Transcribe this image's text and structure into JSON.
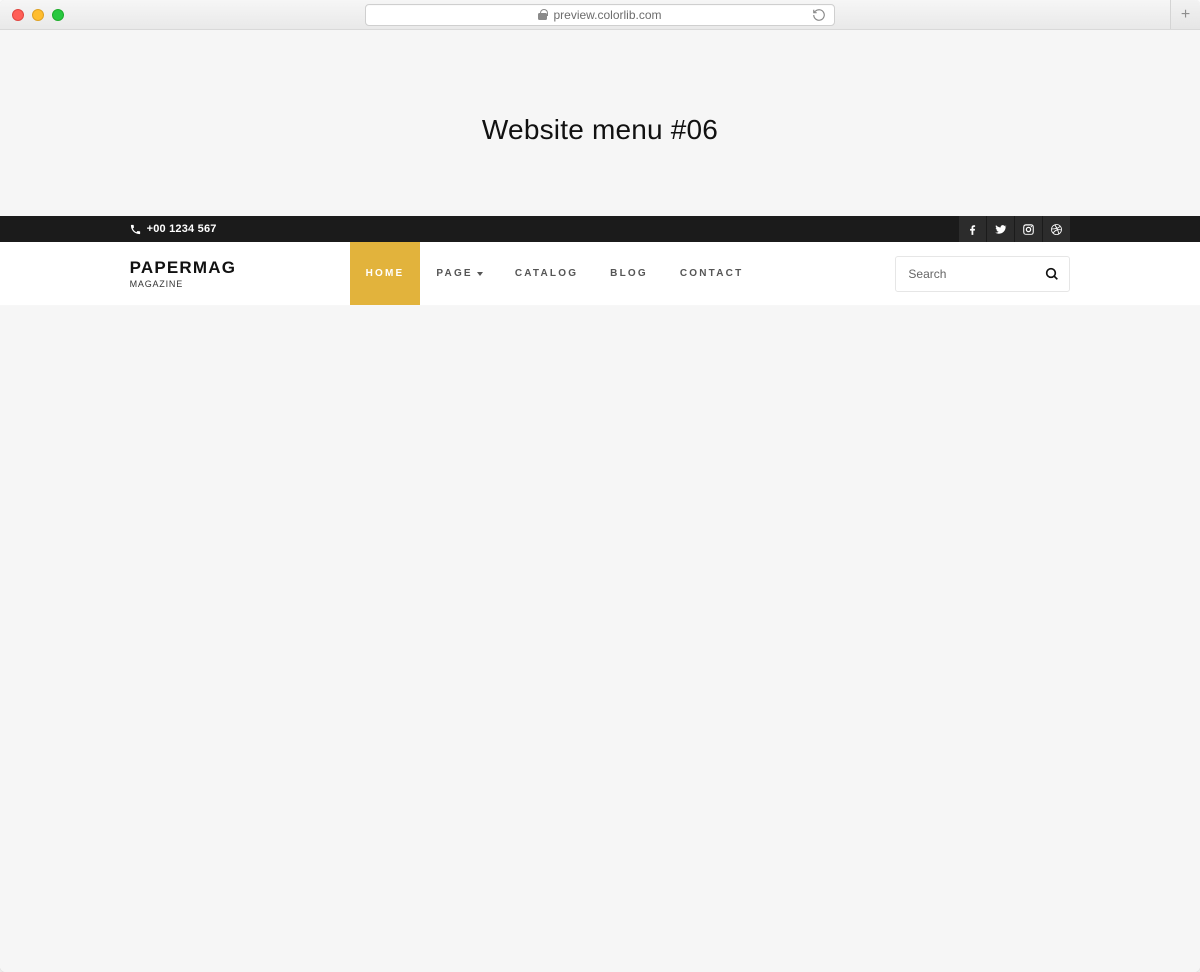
{
  "browser": {
    "address": "preview.colorlib.com"
  },
  "hero": {
    "title": "Website menu #06"
  },
  "topbar": {
    "phone": "+00 1234 567",
    "social": [
      "facebook",
      "twitter",
      "instagram",
      "dribbble"
    ]
  },
  "brand": {
    "title": "PAPERMAG",
    "subtitle": "MAGAZINE"
  },
  "nav": {
    "items": [
      {
        "label": "HOME",
        "active": true,
        "dropdown": false
      },
      {
        "label": "PAGE",
        "active": false,
        "dropdown": true
      },
      {
        "label": "CATALOG",
        "active": false,
        "dropdown": false
      },
      {
        "label": "BLOG",
        "active": false,
        "dropdown": false
      },
      {
        "label": "CONTACT",
        "active": false,
        "dropdown": false
      }
    ]
  },
  "search": {
    "placeholder": "Search"
  }
}
